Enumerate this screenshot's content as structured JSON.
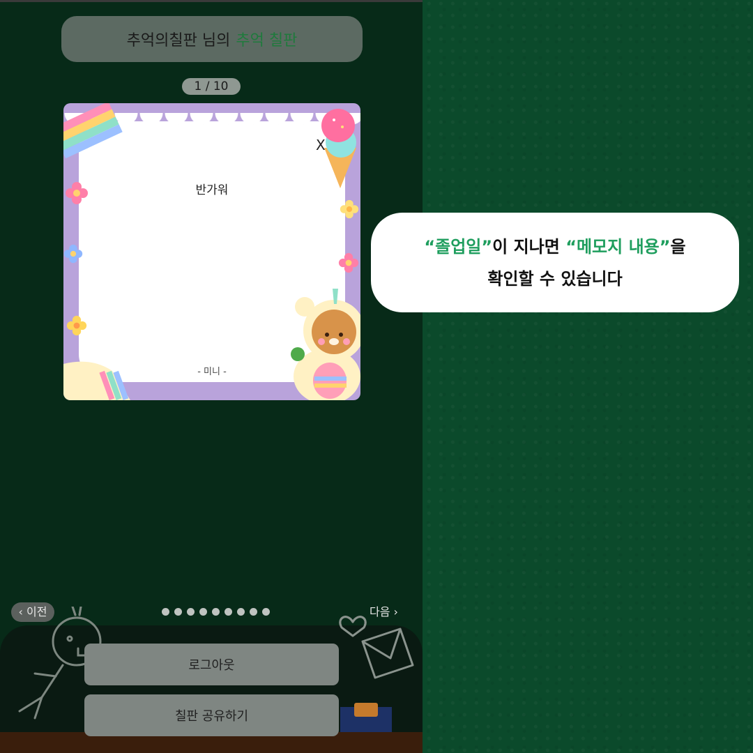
{
  "header": {
    "title_prefix": "추억의칠판 님의",
    "title_accent": "추억 칠판"
  },
  "counter": "1 / 10",
  "memo": {
    "close_label": "X",
    "message": "반가워",
    "signature": "- 미니 -"
  },
  "pagination": {
    "prev_label": "‹ 이전",
    "next_label": "다음 ›",
    "dot_count": 9
  },
  "buttons": {
    "logout": "로그아웃",
    "share": "칠판 공유하기"
  },
  "callout": {
    "q1": "“졸업일”",
    "t1": "이 지나면 ",
    "q2": "“메모지 내용”",
    "t2": "을",
    "line2": "확인할 수 있습니다"
  },
  "colors": {
    "background": "#0b4a2b",
    "accent_green": "#1f9e5e",
    "memo_border": "#b9a3db"
  }
}
